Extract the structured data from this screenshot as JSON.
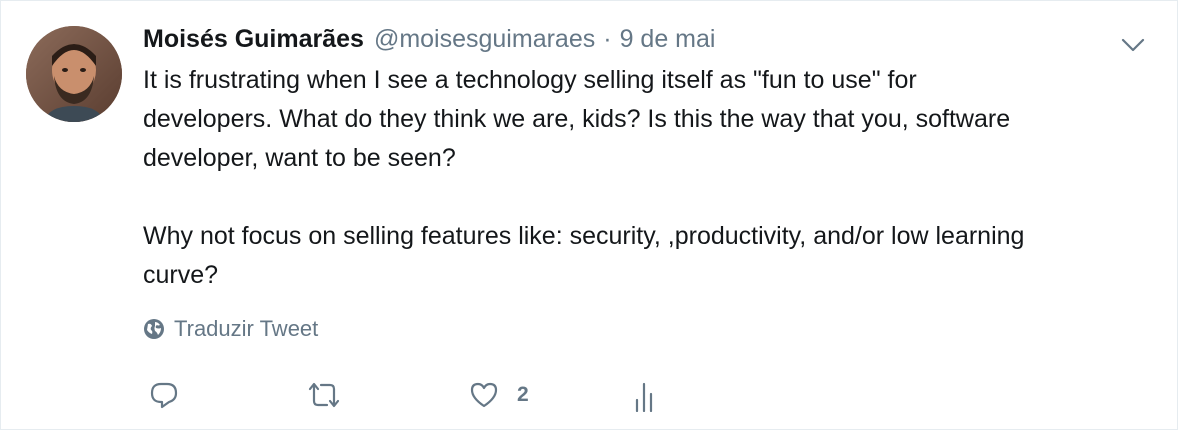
{
  "tweet": {
    "author_name": "Moisés Guimarães",
    "author_handle": "@moisesguimaraes",
    "separator": "·",
    "date": "9 de mai",
    "text": "It is frustrating when I see a technology selling itself as \"fun to use\" for\ndevelopers. What do they think we are, kids? Is this the way that you, software\ndeveloper, want to be seen?\n\nWhy not focus on selling features like: security, ,productivity, and/or low learning\ncurve?",
    "translate_label": "Traduzir Tweet",
    "like_count": "2"
  },
  "icons": {
    "avatar": "avatar-photo",
    "caret": "chevron-down-icon",
    "translate": "globe-icon",
    "reply": "reply-icon",
    "retweet": "retweet-icon",
    "like": "heart-icon",
    "analytics": "analytics-icon"
  },
  "colors": {
    "text": "#14171a",
    "secondary": "#657786",
    "border": "#e6ecf0"
  }
}
